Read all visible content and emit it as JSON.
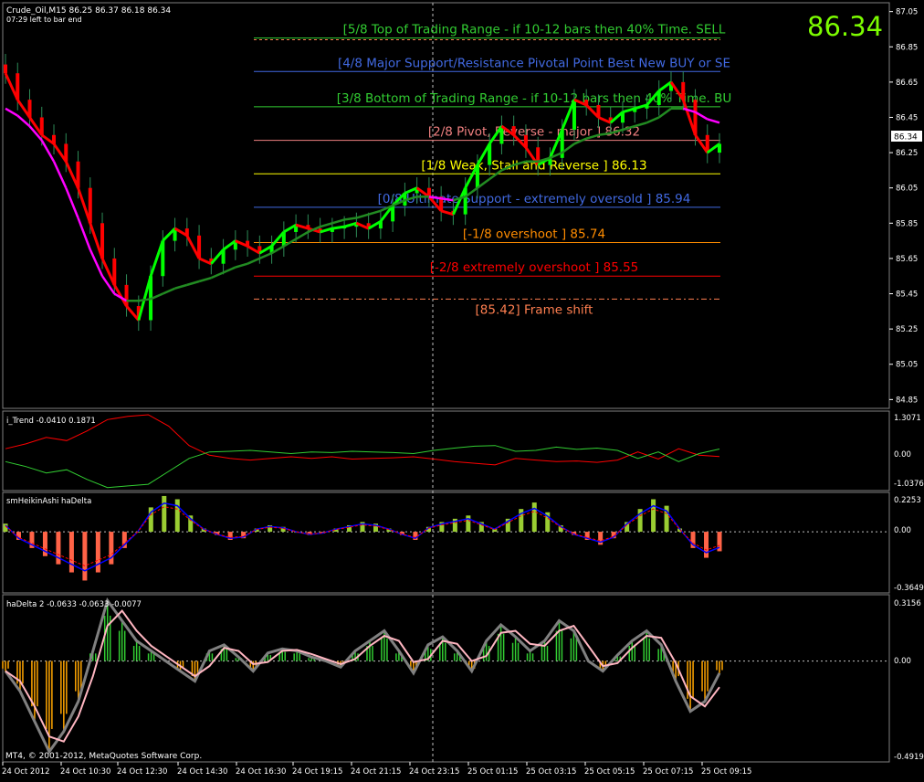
{
  "header": {
    "symbol_line": "Crude_Oil,M15  86.25 86.37 86.18 86.34",
    "timer_line": "07:29 left to bar end",
    "big_price": "86.34",
    "big_price_color": "#7cfc00"
  },
  "main_panel": {
    "price_axis_ticks": [
      "87.05",
      "86.85",
      "86.65",
      "86.45",
      "86.25",
      "86.05",
      "85.85",
      "85.65",
      "85.45",
      "85.25",
      "85.05",
      "84.85"
    ],
    "ylim": [
      84.8,
      87.1
    ],
    "current_price_label": "86.34",
    "current_price": 86.34,
    "murrey_levels": [
      {
        "price": 86.89,
        "label": "",
        "color": "#ff7f50",
        "style": "dotted"
      },
      {
        "price": 86.9,
        "label": "[5/8  Top of Trading Range - if 10-12 bars then 40% Time. SELL",
        "color": "#32cd32",
        "style": "solid"
      },
      {
        "price": 86.71,
        "label": "[4/8  Major Support/Resistance Pivotal Point Best New BUY or SE",
        "color": "#4169e1",
        "style": "solid"
      },
      {
        "price": 86.51,
        "label": "[3/8  Bottom of Trading Range - if 10-12 bars then 40% Time. BU",
        "color": "#32cd32",
        "style": "solid"
      },
      {
        "price": 86.32,
        "label": "[2/8  Pivot, Reverse - major ]  86.32",
        "color": "#f08080",
        "style": "solid"
      },
      {
        "price": 86.13,
        "label": "[1/8  Weak, Stall and Reverse ]  86.13",
        "color": "#ffff00",
        "style": "solid"
      },
      {
        "price": 85.94,
        "label": "[0/8  Ultimate Support - extremely oversold ]  85.94",
        "color": "#4169e1",
        "style": "solid"
      },
      {
        "price": 85.74,
        "label": "[-1/8  overshoot ]  85.74",
        "color": "#ff8c00",
        "style": "solid"
      },
      {
        "price": 85.55,
        "label": "[-2/8  extremely overshoot ]  85.55",
        "color": "#ff0000",
        "style": "solid"
      },
      {
        "price": 85.42,
        "label": "[85.42] Frame shift",
        "color": "#ff7f50",
        "style": "dashdot"
      }
    ]
  },
  "x_axis": {
    "labels": [
      "24 Oct 2012",
      "24 Oct 10:30",
      "24 Oct 12:30",
      "24 Oct 14:30",
      "24 Oct 16:30",
      "24 Oct 19:15",
      "24 Oct 21:15",
      "24 Oct 23:15",
      "25 Oct 01:15",
      "25 Oct 03:15",
      "25 Oct 05:15",
      "25 Oct 07:15",
      "25 Oct 09:15"
    ]
  },
  "itrend_panel": {
    "title": "i_Trend -0.0410 0.1871",
    "ticks": [
      "1.3071",
      "0.00",
      "-1.0376"
    ]
  },
  "heikin_panel": {
    "title": "smHeikinAshi haDelta",
    "ticks": [
      "0.2253",
      "0.00",
      "-0.3649"
    ]
  },
  "hadelta_panel": {
    "title": "haDelta 2 -0.0633 -0.0633 -0.0077",
    "ticks": [
      "0.3156",
      "0.00",
      "-0.4919"
    ]
  },
  "footer": {
    "copyright": "MT4, © 2001-2012, MetaQuotes Software Corp."
  },
  "chart_data": [
    {
      "type": "line",
      "title": "Crude_Oil,M15",
      "ylim": [
        84.8,
        87.1
      ],
      "series": [
        {
          "values": [
            86.7,
            86.55,
            86.45,
            86.35,
            86.3,
            86.2,
            86.05,
            85.85,
            85.65,
            85.5,
            85.38,
            85.3,
            85.55,
            85.75,
            85.82,
            85.78,
            85.65,
            85.62,
            85.7,
            85.75,
            85.72,
            85.68,
            85.72,
            85.8,
            85.84,
            85.82,
            85.8,
            85.82,
            85.83,
            85.85,
            85.82,
            85.86,
            85.95,
            86.02,
            86.05,
            86.0,
            85.92,
            85.9,
            86.05,
            86.18,
            86.3,
            86.4,
            86.35,
            86.28,
            86.18,
            86.22,
            86.38,
            86.55,
            86.52,
            86.45,
            86.42,
            86.48,
            86.5,
            86.52,
            86.6,
            86.65,
            86.55,
            86.35,
            86.25,
            86.3
          ]
        },
        {
          "values": [
            86.5,
            86.46,
            86.4,
            86.32,
            86.2,
            86.05,
            85.88,
            85.7,
            85.55,
            85.45,
            85.41,
            85.41,
            85.42,
            85.45,
            85.48,
            85.5,
            85.52,
            85.54,
            85.57,
            85.6,
            85.62,
            85.65,
            85.68,
            85.72,
            85.76,
            85.8,
            85.83,
            85.85,
            85.87,
            85.88,
            85.9,
            85.92,
            85.95,
            85.98,
            86.0,
            86.0,
            85.99,
            85.98,
            86.0,
            86.05,
            86.1,
            86.15,
            86.18,
            86.2,
            86.2,
            86.22,
            86.25,
            86.3,
            86.33,
            86.35,
            86.36,
            86.38,
            86.4,
            86.42,
            86.45,
            86.5,
            86.5,
            86.48,
            86.44,
            86.42
          ]
        }
      ]
    },
    {
      "type": "line",
      "title": "i_Trend",
      "series": [
        {
          "values": [
            0.2,
            0.35,
            0.55,
            0.45,
            0.75,
            1.1,
            1.2,
            1.25,
            0.9,
            0.3,
            0.0,
            -0.1,
            -0.15,
            -0.1,
            -0.05,
            -0.1,
            -0.05,
            -0.12,
            -0.1,
            -0.08,
            -0.05,
            -0.12,
            -0.2,
            -0.25,
            -0.3,
            -0.1,
            -0.15,
            -0.2,
            -0.18,
            -0.22,
            -0.15,
            0.1,
            -0.12,
            0.2,
            0.0,
            -0.04
          ]
        },
        {
          "values": [
            -0.2,
            -0.35,
            -0.55,
            -0.45,
            -0.75,
            -1.0,
            -0.95,
            -0.9,
            -0.5,
            -0.1,
            0.1,
            0.12,
            0.15,
            0.1,
            0.05,
            0.1,
            0.08,
            0.12,
            0.1,
            0.08,
            0.05,
            0.15,
            0.22,
            0.28,
            0.3,
            0.12,
            0.15,
            0.25,
            0.18,
            0.22,
            0.15,
            -0.1,
            0.1,
            -0.2,
            0.05,
            0.19
          ]
        }
      ]
    },
    {
      "type": "bar",
      "title": "smHeikinAshi haDelta",
      "values": [
        0.05,
        -0.05,
        -0.1,
        -0.15,
        -0.2,
        -0.25,
        -0.3,
        -0.25,
        -0.2,
        -0.1,
        0.0,
        0.15,
        0.22,
        0.2,
        0.1,
        0.02,
        -0.02,
        -0.05,
        -0.04,
        0.02,
        0.04,
        0.03,
        0.0,
        -0.02,
        -0.01,
        0.02,
        0.04,
        0.06,
        0.05,
        0.02,
        -0.02,
        -0.05,
        0.03,
        0.06,
        0.08,
        0.1,
        0.06,
        0.02,
        0.08,
        0.14,
        0.18,
        0.12,
        0.04,
        -0.02,
        -0.05,
        -0.08,
        -0.04,
        0.06,
        0.14,
        0.2,
        0.16,
        0.02,
        -0.1,
        -0.16,
        -0.12
      ]
    },
    {
      "type": "bar",
      "title": "haDelta 2",
      "values": [
        -0.05,
        -0.15,
        -0.3,
        -0.45,
        -0.35,
        -0.2,
        0.05,
        0.3,
        0.2,
        0.1,
        0.05,
        0.0,
        -0.05,
        -0.1,
        0.05,
        0.08,
        0.02,
        -0.05,
        0.04,
        0.06,
        0.05,
        0.02,
        0.0,
        -0.03,
        0.05,
        0.1,
        0.15,
        0.05,
        -0.06,
        0.08,
        0.12,
        0.05,
        -0.05,
        0.1,
        0.18,
        0.12,
        0.05,
        0.1,
        0.2,
        0.15,
        0.0,
        -0.05,
        0.03,
        0.1,
        0.15,
        0.08,
        -0.1,
        -0.25,
        -0.2,
        -0.06
      ]
    }
  ]
}
